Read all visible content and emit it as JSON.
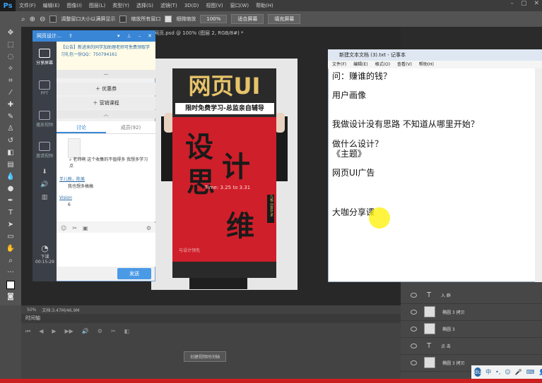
{
  "photoshop": {
    "logo": "Ps",
    "menu": [
      "文件(F)",
      "编辑(E)",
      "图像(I)",
      "图层(L)",
      "类型(Y)",
      "选择(S)",
      "滤镜(T)",
      "3D(D)",
      "视图(V)",
      "窗口(W)",
      "帮助(H)"
    ],
    "options": {
      "chk1": "调整窗口大小以满屏显示",
      "chk2": "缩放所有窗口",
      "chk3": "细微缩放",
      "zoom": "100%",
      "fit": "适合屏幕",
      "fill": "填充屏幕"
    },
    "doc_tab": "网页.psd @ 100% (图层 2, RGB/8#) *",
    "status": {
      "zoom": "50%",
      "doc": "文档:3.47M/46.9M"
    },
    "timeline": {
      "title": "时间轴",
      "create_button": "创建视频时间轴"
    },
    "layers": [
      {
        "type": "text",
        "name": "入 群"
      },
      {
        "type": "shape",
        "name": "椭圆 3 拷贝"
      },
      {
        "type": "shape",
        "name": "椭圆 3"
      },
      {
        "type": "text",
        "name": "点 击"
      },
      {
        "type": "shape",
        "name": "椭圆 3 拷贝"
      }
    ]
  },
  "poster": {
    "title": "网页UI",
    "subtitle": "限时免费学习-总监亲自辅导",
    "calli1": "设",
    "calli2": "计",
    "calli3": "思",
    "calli4": "维",
    "time": "Time: 3.25 to 3.31",
    "vtag": "九格·创意艺术",
    "bottom": "与设计领先"
  },
  "chat": {
    "window_title": "网页设计…",
    "notice": "【公告】新进来的同学加助理老师可免费领取学习礼包一份QQ：750794161",
    "links": [
      "优惠券",
      "营销课程"
    ],
    "tabs": {
      "discuss": "讨论",
      "members": "成员(92)"
    },
    "messages": [
      {
        "user": "",
        "text": "老师啊 这个收集的不值得多 我想多学习点"
      },
      {
        "user": "芋儿粉，陈美",
        "text": "我也想多搞搞"
      },
      {
        "user": "Vision",
        "text": "6"
      }
    ],
    "side": [
      "分享屏幕",
      "PPT",
      "播放视频",
      "邀请视频"
    ],
    "timer_label": "下课",
    "timer": "00:15:29",
    "send": "发送"
  },
  "notepad": {
    "title": "新建文本文档 (3).txt - 记事本",
    "menu": [
      "文件(F)",
      "编辑(E)",
      "格式(O)",
      "查看(V)",
      "帮助(H)"
    ],
    "lines": [
      "问：赚谁的钱？",
      "用户画像",
      "我做设计没有思路 不知道从哪里开始？",
      "做什么设计？",
      "《主题》",
      "网页UI广告",
      "大咖分享课"
    ]
  },
  "tray": {
    "ime": "中"
  }
}
